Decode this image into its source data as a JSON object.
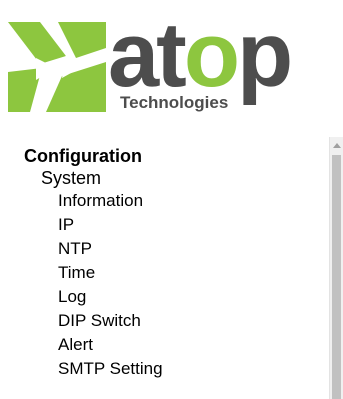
{
  "logo": {
    "brand_prefix": "at",
    "brand_o": "o",
    "brand_suffix": "p",
    "tagline": "Technologies",
    "colors": {
      "green": "#8dc63f",
      "gray": "#4d4d4d"
    }
  },
  "nav": {
    "heading": "Configuration",
    "section": "System",
    "items": [
      {
        "label": "Information"
      },
      {
        "label": "IP"
      },
      {
        "label": "NTP"
      },
      {
        "label": "Time"
      },
      {
        "label": "Log"
      },
      {
        "label": "DIP Switch"
      },
      {
        "label": "Alert"
      },
      {
        "label": "SMTP Setting"
      }
    ]
  },
  "scrollbar": {
    "arrow_icon": "scroll-up-arrow-icon"
  }
}
